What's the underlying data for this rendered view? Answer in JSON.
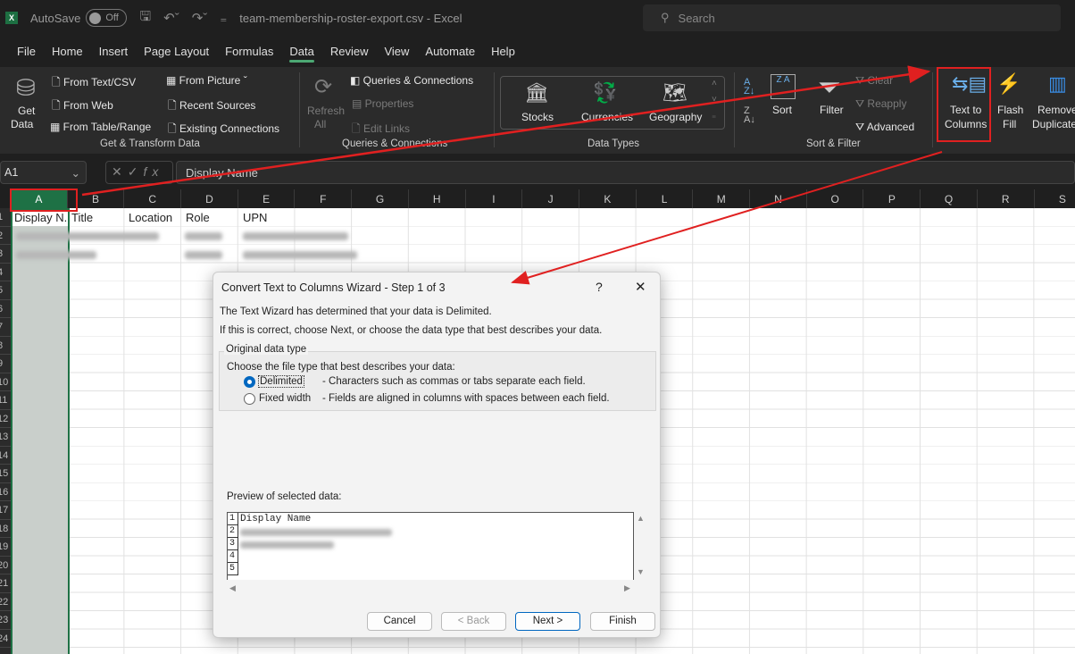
{
  "titlebar": {
    "autosave_label": "AutoSave",
    "autosave_state": "Off",
    "document_title": "team-membership-roster-export.csv  -  Excel",
    "search_placeholder": "Search"
  },
  "tabs": [
    "File",
    "Home",
    "Insert",
    "Page Layout",
    "Formulas",
    "Data",
    "Review",
    "View",
    "Automate",
    "Help"
  ],
  "active_tab": "Data",
  "ribbon": {
    "get_data": "Get",
    "get_data2": "Data",
    "from_text_csv": "From Text/CSV",
    "from_web": "From Web",
    "from_table_range": "From Table/Range",
    "from_picture": "From Picture",
    "recent_sources": "Recent Sources",
    "existing_connections": "Existing Connections",
    "group_get_transform": "Get & Transform Data",
    "refresh": "Refresh",
    "refresh2": "All",
    "queries_connections": "Queries & Connections",
    "properties": "Properties",
    "edit_links": "Edit Links",
    "group_queries": "Queries & Connections",
    "stocks": "Stocks",
    "currencies": "Currencies",
    "geography": "Geography",
    "group_data_types": "Data Types",
    "sort": "Sort",
    "filter": "Filter",
    "clear": "Clear",
    "reapply": "Reapply",
    "advanced": "Advanced",
    "group_sort_filter": "Sort & Filter",
    "text_to_columns": "Text to",
    "text_to_columns2": "Columns",
    "flash_fill": "Flash",
    "flash_fill2": "Fill",
    "remove_duplicates": "Remove",
    "remove_duplicates2": "Duplicates"
  },
  "formula_bar": {
    "name_box": "A1",
    "formula": "Display Name"
  },
  "columns": [
    "A",
    "B",
    "C",
    "D",
    "E",
    "F",
    "G",
    "H",
    "I",
    "J",
    "K",
    "L",
    "M",
    "N",
    "O",
    "P",
    "Q",
    "R",
    "S"
  ],
  "selected_column": "A",
  "rows": [
    "1",
    "2",
    "3",
    "4",
    "5",
    "6",
    "7",
    "8",
    "9",
    "10",
    "11",
    "12",
    "13",
    "14",
    "15",
    "16",
    "17",
    "18",
    "19",
    "20",
    "21",
    "22",
    "23",
    "24"
  ],
  "headers": [
    "Display N.",
    "Title",
    "Location",
    "Role",
    "UPN"
  ],
  "dialog": {
    "title": "Convert Text to Columns Wizard - Step 1 of 3",
    "help": "?",
    "close": "✕",
    "line1": "The Text Wizard has determined that your data is Delimited.",
    "line2": "If this is correct, choose Next, or choose the data type that best describes your data.",
    "group_label": "Original data type",
    "choose_label": "Choose the file type that best describes your data:",
    "options": [
      {
        "label": "Delimited",
        "desc": "- Characters such as commas or tabs separate each field.",
        "selected": true
      },
      {
        "label": "Fixed width",
        "desc": "- Fields are aligned in columns with spaces between each field.",
        "selected": false
      }
    ],
    "preview_label": "Preview of selected data:",
    "preview_rows": [
      "1",
      "2",
      "3",
      "4",
      "5"
    ],
    "preview_line1": "Display Name",
    "buttons": {
      "cancel": "Cancel",
      "back": "< Back",
      "next": "Next >",
      "finish": "Finish"
    }
  },
  "colors": {
    "accent": "#1e7145",
    "annotation": "#e02020",
    "primary_button": "#0067c0"
  }
}
